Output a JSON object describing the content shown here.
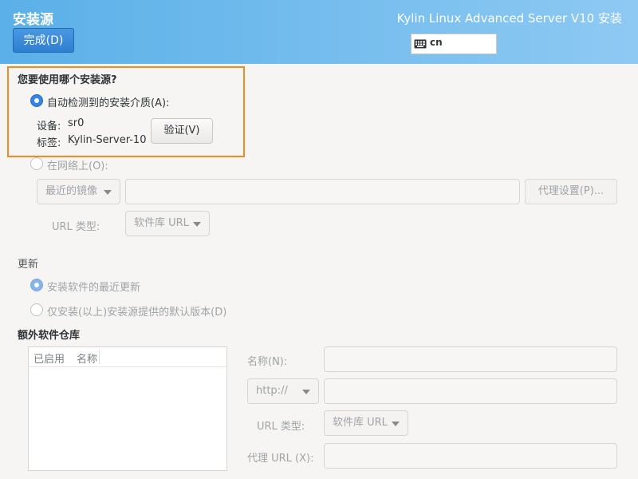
{
  "header": {
    "title": "安装源",
    "product": "Kylin Linux Advanced Server V10 安装",
    "done_button": "完成(D)",
    "keyboard_layout": "cn",
    "keyboard_icon": "keyboard-icon"
  },
  "source": {
    "question": "您要使用哪个安装源?",
    "auto_detect_label": "自动检测到的安装介质(A):",
    "device_label": "设备:",
    "device_value": "sr0",
    "tag_label": "标签:",
    "tag_value": "Kylin-Server-10",
    "verify_button": "验证(V)",
    "network_label": "在网络上(O):",
    "mirror_combo": "最近的镜像",
    "url_value": "",
    "proxy_button": "代理设置(P)...",
    "url_type_label": "URL 类型:",
    "url_type_combo": "软件库 URL"
  },
  "updates": {
    "heading": "更新",
    "option_latest": "安装软件的最近更新",
    "option_default": "仅安装(以上)安装源提供的默认版本(D)"
  },
  "repos": {
    "heading": "额外软件仓库",
    "columns": [
      "已启用",
      "名称"
    ],
    "rows": [],
    "name_label": "名称(N):",
    "name_value": "",
    "protocol_combo": "http://",
    "repo_url_value": "",
    "url_type_label": "URL 类型:",
    "url_type_combo": "软件库 URL",
    "proxy_url_label": "代理 URL (X):",
    "proxy_url_value": ""
  },
  "colors": {
    "header_start": "#5ab0e8",
    "header_end": "#8ec9f3",
    "accent": "#3584e4",
    "highlight": "#f08a24"
  }
}
